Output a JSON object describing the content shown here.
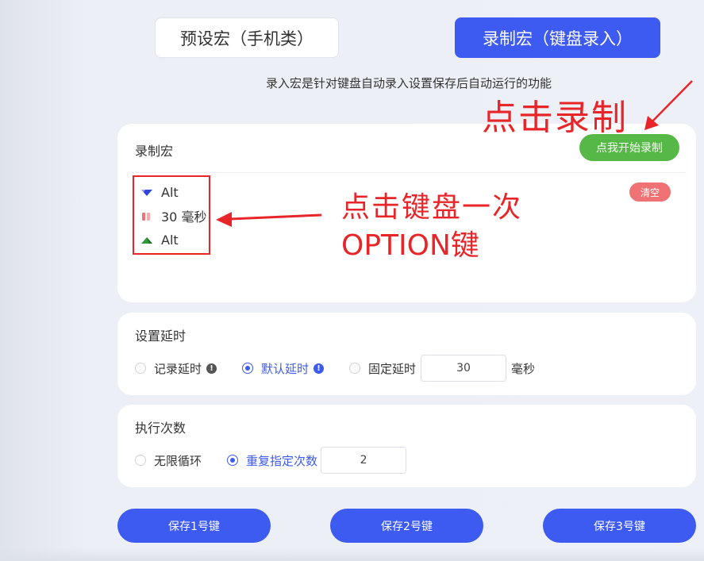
{
  "tabs": {
    "preset_label": "预设宏（手机类）",
    "record_label": "录制宏（键盘录入）"
  },
  "description": "录入宏是针对键盘自动录入设置保存后自动运行的功能",
  "record_card": {
    "title": "录制宏",
    "start_button": "点我开始录制",
    "clear_button": "清空",
    "items": [
      {
        "icon": "key-down-icon",
        "label": "Alt"
      },
      {
        "icon": "delay-icon",
        "label": "30 毫秒"
      },
      {
        "icon": "key-up-icon",
        "label": "Alt"
      }
    ]
  },
  "delay_card": {
    "title": "设置延时",
    "options": [
      {
        "label": "记录延时",
        "checked": false
      },
      {
        "label": "默认延时",
        "checked": true
      },
      {
        "label": "固定延时",
        "checked": false
      }
    ],
    "fixed_value": "30",
    "unit": "毫秒"
  },
  "exec_card": {
    "title": "执行次数",
    "options": [
      {
        "label": "无限循环",
        "checked": false
      },
      {
        "label": "重复指定次数",
        "checked": true
      }
    ],
    "count_value": "2"
  },
  "save_buttons": [
    "保存1号键",
    "保存2号键",
    "保存3号键"
  ],
  "annotations": {
    "click_record": "点击录制",
    "click_key_line1": "点击键盘一次",
    "click_key_line2": "OPTION键"
  },
  "colors": {
    "primary": "#3d5af1",
    "green": "#56b846",
    "clear": "#f07274",
    "annotation": "#e8262a"
  }
}
